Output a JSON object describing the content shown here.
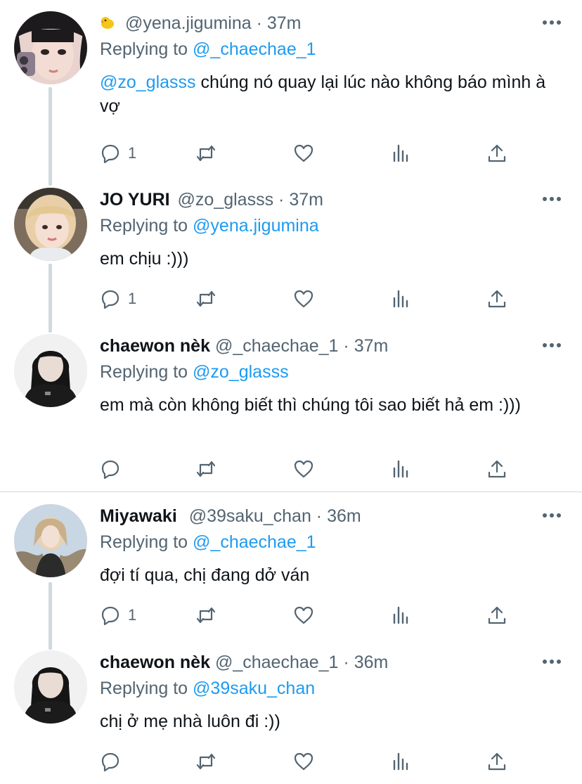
{
  "replying_prefix": "Replying to",
  "tweets": [
    {
      "display_name": "",
      "handle": "@yena.jigumina",
      "time": "37m",
      "replying_to": "@_chaechae_1",
      "mention": "@zo_glasss",
      "text": " chúng nó quay lại lúc nào không báo mình à vợ",
      "reply_count": "1",
      "avatar": "avatar-yena",
      "icon": "duck-emoji-icon"
    },
    {
      "display_name": "JO YURI",
      "handle": "@zo_glasss",
      "time": "37m",
      "replying_to": "@yena.jigumina",
      "mention": "",
      "text": "em chịu :)))",
      "reply_count": "1",
      "avatar": "avatar-joyuri"
    },
    {
      "display_name": "chaewon nèk",
      "handle": "@_chaechae_1",
      "time": "37m",
      "replying_to": "@zo_glasss",
      "mention": "",
      "text": "em mà còn không biết thì chúng tôi sao biết hả em :)))",
      "reply_count": "",
      "avatar": "avatar-chaewon"
    },
    {
      "display_name": "Miyawaki",
      "handle": "@39saku_chan",
      "time": "36m",
      "replying_to": "@_chaechae_1",
      "mention": "",
      "text": "đợi tí qua, chị đang dở ván",
      "reply_count": "1",
      "avatar": "avatar-miyawaki"
    },
    {
      "display_name": "chaewon nèk",
      "handle": "@_chaechae_1",
      "time": "36m",
      "replying_to": "@39saku_chan",
      "mention": "",
      "text": "chị ở mẹ nhà luôn đi :))",
      "reply_count": "",
      "avatar": "avatar-chaewon"
    }
  ],
  "separator": "·",
  "colors": {
    "link": "#1d9bf0",
    "muted": "#536471",
    "text": "#0f1419",
    "line": "#cfd9de"
  }
}
